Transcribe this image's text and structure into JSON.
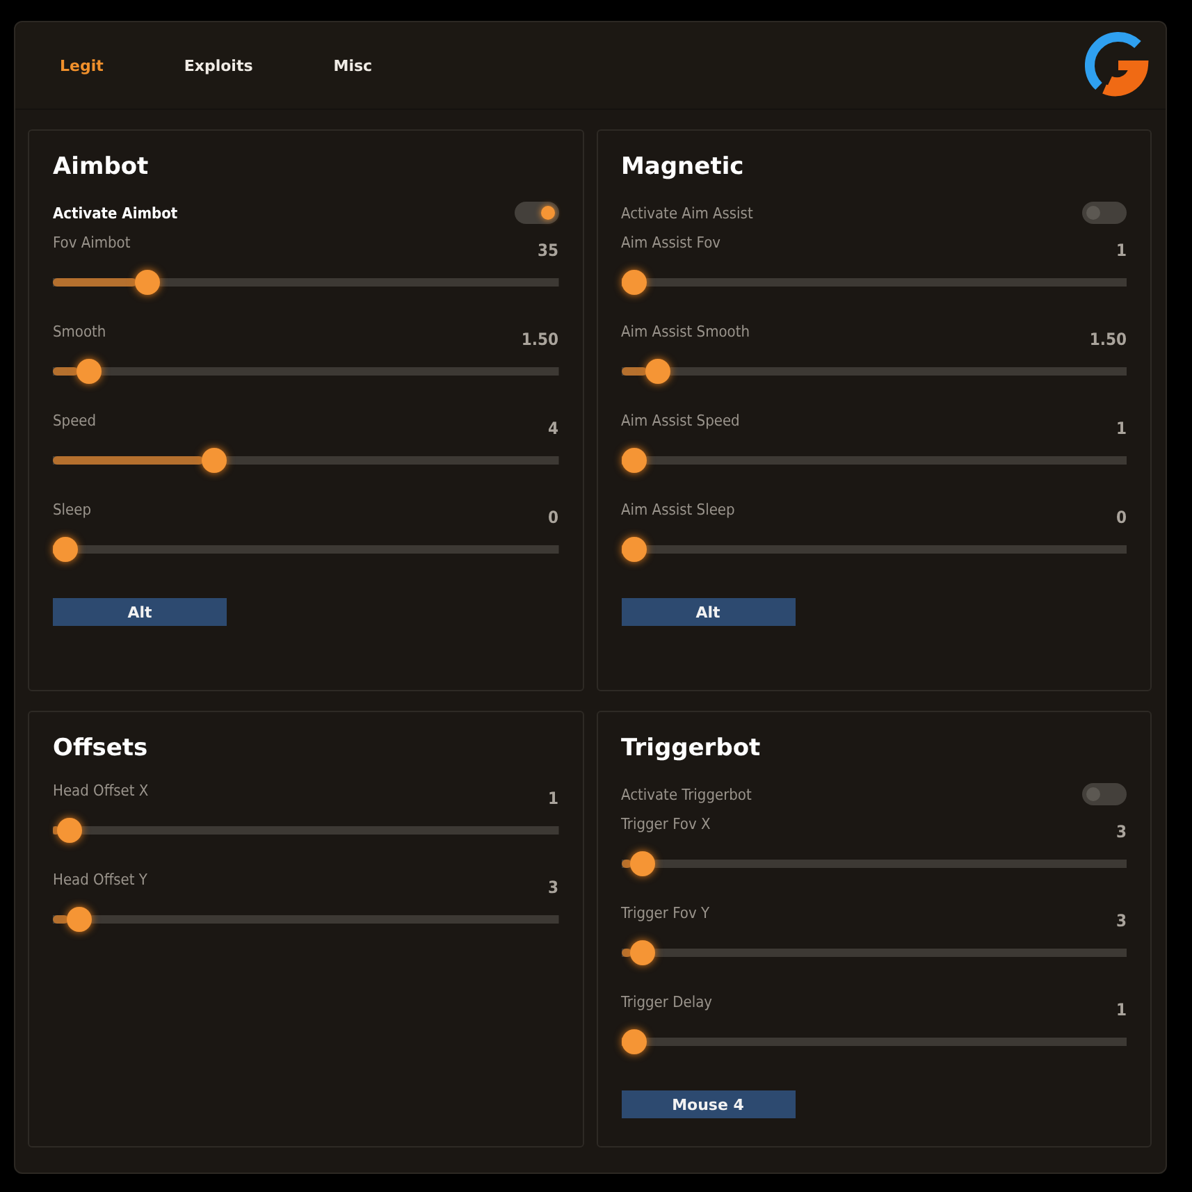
{
  "tabs": [
    {
      "label": "Legit",
      "selected": true
    },
    {
      "label": "Exploits",
      "selected": false
    },
    {
      "label": "Misc",
      "selected": false
    }
  ],
  "panels": [
    {
      "title": "Aimbot",
      "items": [
        {
          "kind": "toggle",
          "label": "Activate Aimbot",
          "on": true
        },
        {
          "kind": "slider",
          "label": "Fov Aimbot",
          "value": "35",
          "level": 0.17
        },
        {
          "kind": "slider",
          "label": "Smooth",
          "value": "1.50",
          "level": 0.05
        },
        {
          "kind": "slider",
          "label": "Speed",
          "value": "4",
          "level": 0.31
        },
        {
          "kind": "slider",
          "label": "Sleep",
          "value": "0",
          "level": 0
        },
        {
          "kind": "keybind",
          "label": "Alt"
        }
      ]
    },
    {
      "title": "Magnetic",
      "items": [
        {
          "kind": "toggle",
          "label": "Activate Aim Assist",
          "on": false
        },
        {
          "kind": "slider",
          "label": "Aim Assist Fov",
          "value": "1",
          "level": 0
        },
        {
          "kind": "slider",
          "label": "Aim Assist Smooth",
          "value": "1.50",
          "level": 0.05
        },
        {
          "kind": "slider",
          "label": "Aim Assist Speed",
          "value": "1",
          "level": 0
        },
        {
          "kind": "slider",
          "label": "Aim Assist Sleep",
          "value": "0",
          "level": 0
        },
        {
          "kind": "keybind",
          "label": "Alt"
        }
      ]
    },
    {
      "title": "Offsets",
      "items": [
        {
          "kind": "slider",
          "label": "Head Offset X",
          "value": "1",
          "level": 0.01
        },
        {
          "kind": "slider",
          "label": "Head Offset Y",
          "value": "3",
          "level": 0.03
        }
      ]
    },
    {
      "title": "Triggerbot",
      "items": [
        {
          "kind": "toggle",
          "label": "Activate Triggerbot",
          "on": false
        },
        {
          "kind": "slider",
          "label": "Trigger Fov X",
          "value": "3",
          "level": 0.02
        },
        {
          "kind": "slider",
          "label": "Trigger Fov Y",
          "value": "3",
          "level": 0.02
        },
        {
          "kind": "slider",
          "label": "Trigger Delay",
          "value": "1",
          "level": 0
        },
        {
          "kind": "keybind",
          "label": "Mouse 4"
        }
      ]
    }
  ]
}
